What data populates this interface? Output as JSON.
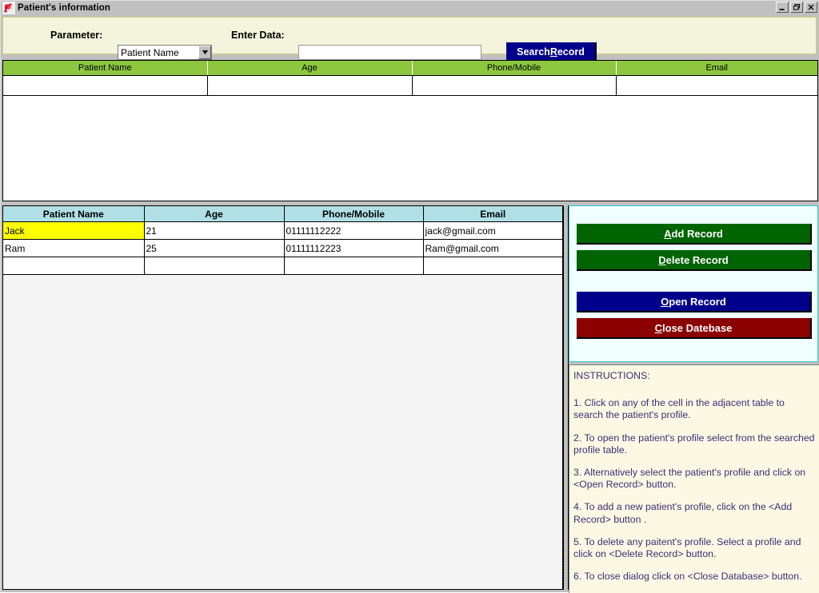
{
  "window": {
    "title": "Patient's information",
    "icon": "bird-flag-icon",
    "minimize_label": "_",
    "restore_label": "❐",
    "close_label": "✕"
  },
  "search_bar": {
    "parameter_label": "Parameter:",
    "parameter_selected": "Patient Name",
    "parameter_options": [
      "Patient Name"
    ],
    "enter_data_label": "Enter Data:",
    "enter_data_value": "",
    "enter_data_placeholder": "",
    "search_button": {
      "prefix": "Search ",
      "accesskey": "R",
      "suffix": "ecord",
      "full_label": "Search Record",
      "bg_color": "#00008b"
    }
  },
  "search_results_grid": {
    "header_color": "#8dc63f",
    "columns": [
      "Patient Name",
      "Age",
      "Phone/Mobile",
      "Email"
    ],
    "rows": [
      [
        "",
        "",
        "",
        ""
      ]
    ]
  },
  "records_grid": {
    "header_color": "#b0e0e6",
    "selected_cell_color": "#ffff00",
    "columns": [
      "Patient Name",
      "Age",
      "Phone/Mobile",
      "Email"
    ],
    "rows": [
      {
        "name": "Jack",
        "age": "21",
        "phone": "01111112222",
        "email": "jack@gmail.com",
        "selected": true
      },
      {
        "name": "Ram",
        "age": "25",
        "phone": "01111112223",
        "email": "Ram@gmail.com",
        "selected": false
      },
      {
        "name": "",
        "age": "",
        "phone": "",
        "email": "",
        "selected": false
      }
    ]
  },
  "actions": {
    "add_record": {
      "prefix": "",
      "accesskey": "A",
      "suffix": "dd Record",
      "full_label": "Add Record",
      "color": "#006400"
    },
    "delete_record": {
      "prefix": "",
      "accesskey": "D",
      "suffix": "elete Record",
      "full_label": "Delete Record",
      "color": "#006400"
    },
    "open_record": {
      "prefix": "",
      "accesskey": "O",
      "suffix": "pen Record",
      "full_label": "Open Record",
      "color": "#00008b"
    },
    "close_database": {
      "prefix": "",
      "accesskey": "C",
      "suffix": "lose Datebase",
      "full_label": "Close Datebase",
      "color": "#8b0000"
    }
  },
  "instructions": {
    "title": "INSTRUCTIONS:",
    "text_color": "#3b2f78",
    "items": [
      "1. Click on any of the cell in the adjacent table to search the patient's profile.",
      "2. To open the patient's profile select from the searched profile table.",
      "3. Alternatively select the patient's profile and click on <Open Record> button.",
      "4. To add a new patient's profile, click on the <Add Record> button .",
      "5. To delete any paitent's profile. Select a profile and click on <Delete Record> button.",
      "6. To close dialog click on <Close Database> button."
    ]
  }
}
